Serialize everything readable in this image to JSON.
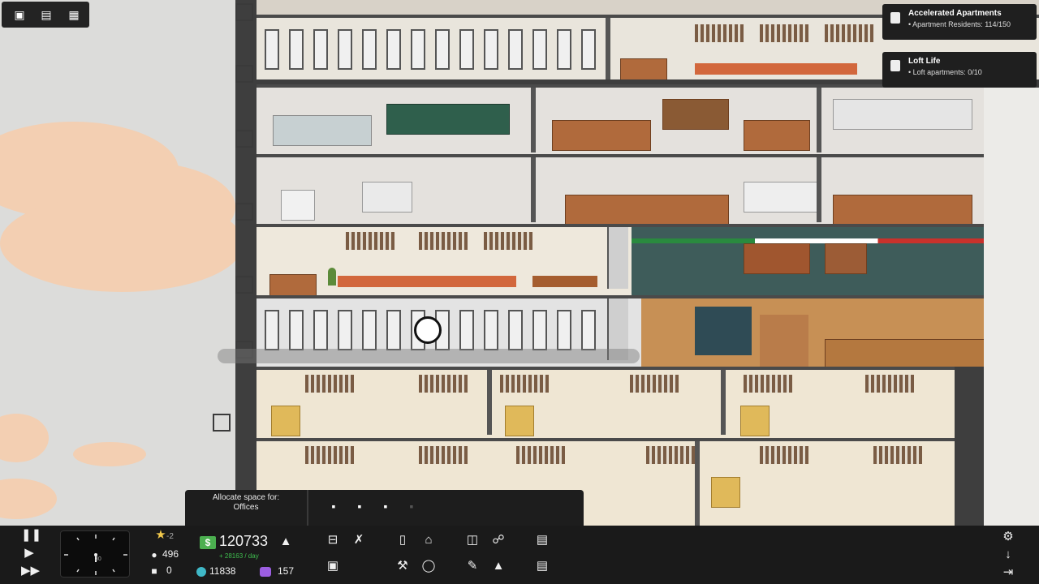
{
  "toolbar": {
    "buttons": [
      {
        "name": "windows-icon"
      },
      {
        "name": "stats-icon"
      },
      {
        "name": "building-icon"
      }
    ]
  },
  "notifications": [
    {
      "title": "Accelerated Apartments",
      "detail": "Apartment Residents: 114/150"
    },
    {
      "title": "Loft Life",
      "detail": "Loft apartments: 0/10"
    }
  ],
  "allocate": {
    "label_line1": "Allocate space for:",
    "label_line2": "Offices"
  },
  "bottom_bar": {
    "stars": "-2",
    "population": "496",
    "vacancies": "0",
    "money": "120733",
    "income": "+ 28163 / day",
    "research": "11838",
    "influence": "157",
    "clock_label": "30"
  },
  "colors": {
    "money_badge": "#4caf50",
    "income_text": "#3fbf4f",
    "research_icon": "#3fb8c7",
    "influence_icon": "#9b5ee0",
    "star": "#f2c94c"
  }
}
